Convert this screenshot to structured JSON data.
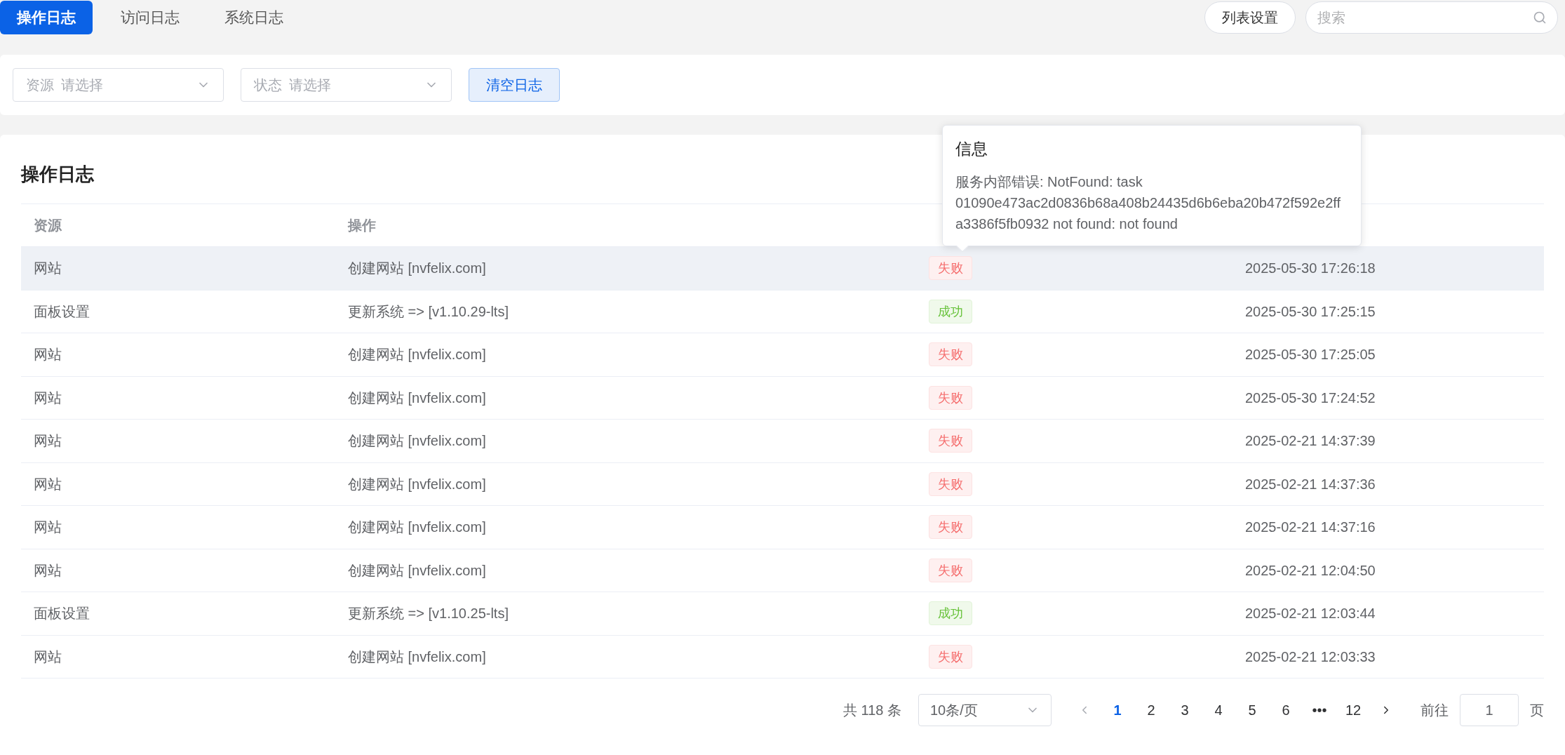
{
  "tabs": [
    {
      "label": "操作日志",
      "selected": true
    },
    {
      "label": "访问日志",
      "selected": false
    },
    {
      "label": "系统日志",
      "selected": false
    }
  ],
  "list_settings_button": "列表设置",
  "search": {
    "placeholder": "搜索"
  },
  "filters": [
    {
      "label": "资源",
      "placeholder": "请选择"
    },
    {
      "label": "状态",
      "placeholder": "请选择"
    }
  ],
  "clear_button": "清空日志",
  "table": {
    "title": "操作日志",
    "columns": [
      "资源",
      "操作",
      ""
    ],
    "rows": [
      {
        "resource": "网站",
        "action": "创建网站 [nvfelix.com]",
        "status": {
          "label": "失败",
          "kind": "fail"
        },
        "time": "2025-05-30 17:26:18",
        "selected": true
      },
      {
        "resource": "面板设置",
        "action": "更新系统 => [v1.10.29-lts]",
        "status": {
          "label": "成功",
          "kind": "success"
        },
        "time": "2025-05-30 17:25:15",
        "selected": false
      },
      {
        "resource": "网站",
        "action": "创建网站 [nvfelix.com]",
        "status": {
          "label": "失败",
          "kind": "fail"
        },
        "time": "2025-05-30 17:25:05",
        "selected": false
      },
      {
        "resource": "网站",
        "action": "创建网站 [nvfelix.com]",
        "status": {
          "label": "失败",
          "kind": "fail"
        },
        "time": "2025-05-30 17:24:52",
        "selected": false
      },
      {
        "resource": "网站",
        "action": "创建网站 [nvfelix.com]",
        "status": {
          "label": "失败",
          "kind": "fail"
        },
        "time": "2025-02-21 14:37:39",
        "selected": false
      },
      {
        "resource": "网站",
        "action": "创建网站 [nvfelix.com]",
        "status": {
          "label": "失败",
          "kind": "fail"
        },
        "time": "2025-02-21 14:37:36",
        "selected": false
      },
      {
        "resource": "网站",
        "action": "创建网站 [nvfelix.com]",
        "status": {
          "label": "失败",
          "kind": "fail"
        },
        "time": "2025-02-21 14:37:16",
        "selected": false
      },
      {
        "resource": "网站",
        "action": "创建网站 [nvfelix.com]",
        "status": {
          "label": "失败",
          "kind": "fail"
        },
        "time": "2025-02-21 12:04:50",
        "selected": false
      },
      {
        "resource": "面板设置",
        "action": "更新系统 => [v1.10.25-lts]",
        "status": {
          "label": "成功",
          "kind": "success"
        },
        "time": "2025-02-21 12:03:44",
        "selected": false
      },
      {
        "resource": "网站",
        "action": "创建网站 [nvfelix.com]",
        "status": {
          "label": "失败",
          "kind": "fail"
        },
        "time": "2025-02-21 12:03:33",
        "selected": false
      }
    ]
  },
  "tooltip": {
    "title": "信息",
    "message": "服务内部错误: NotFound: task 01090e473ac2d0836b68a408b24435d6b6eba20b472f592e2ffa3386f5fb0932 not found: not found"
  },
  "pagination": {
    "total": "共 118 条",
    "page_size": "10条/页",
    "pages": [
      {
        "label": "1",
        "selected": true
      },
      {
        "label": "2",
        "selected": false
      },
      {
        "label": "3",
        "selected": false
      },
      {
        "label": "4",
        "selected": false
      },
      {
        "label": "5",
        "selected": false
      },
      {
        "label": "6",
        "selected": false
      },
      {
        "label": "•••",
        "selected": false
      },
      {
        "label": "12",
        "selected": false
      }
    ],
    "goto_label": "前往",
    "goto_value": "1",
    "goto_suffix": "页"
  }
}
